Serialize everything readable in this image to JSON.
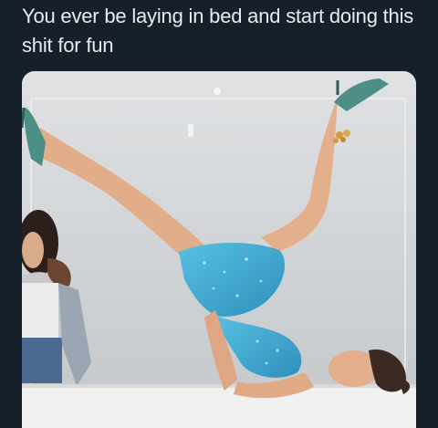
{
  "post": {
    "caption": "You ever be laying in bed and start doing this shit for fun"
  },
  "media": {
    "type": "photo",
    "subject": "person in blue sequin dress doing shoulder-stand leg split inside glass box",
    "colors": {
      "background": "#15202b",
      "caption_text": "#e8ecef",
      "backdrop": "#cfd2d5",
      "dress": "#3fa7cf",
      "skin": "#e6b28f",
      "floor": "#f1f1ef"
    }
  }
}
